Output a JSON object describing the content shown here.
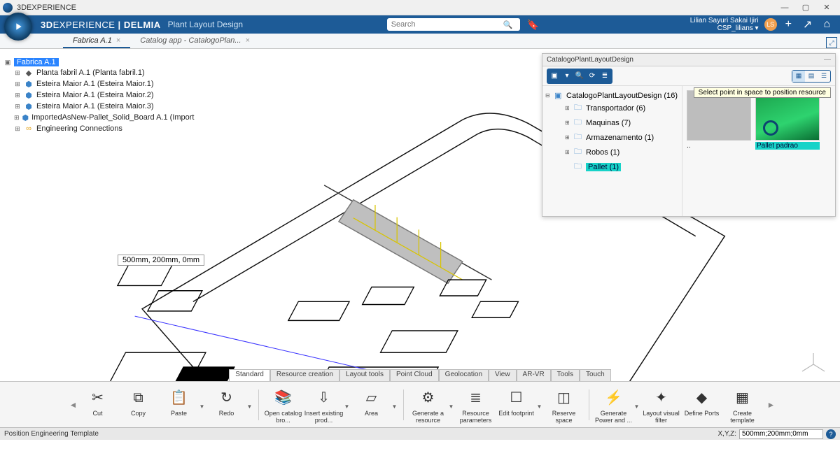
{
  "window": {
    "title": "3DEXPERIENCE"
  },
  "header": {
    "brand_bold": "3D",
    "brand_light": "EXPERIENCE",
    "divider": " | ",
    "suite": "DELMIA",
    "app": "Plant Layout Design",
    "search_placeholder": "Search",
    "user_fullname": "Lilian Sayuri Sakai Ijiri",
    "user_role": "CSP_lilians",
    "avatar_initials": "LS"
  },
  "tabs": [
    {
      "label": "Fabrica A.1",
      "active": true
    },
    {
      "label": "Catalog app - CatalogoPlan...",
      "active": false
    }
  ],
  "tree": {
    "root": "Fabrica A.1",
    "children": [
      {
        "icon": "cube",
        "label": "Planta fabril A.1 (Planta fabril.1)"
      },
      {
        "icon": "cyl",
        "label": "Esteira Maior A.1 (Esteira Maior.1)"
      },
      {
        "icon": "cyl",
        "label": "Esteira Maior A.1 (Esteira Maior.2)"
      },
      {
        "icon": "cyl",
        "label": "Esteira Maior A.1 (Esteira Maior.3)"
      },
      {
        "icon": "cyl",
        "label": "ImportedAsNew-Pallet_Solid_Board A.1 (Import"
      },
      {
        "icon": "link",
        "label": "Engineering Connections"
      }
    ]
  },
  "coord_tooltip": "500mm, 200mm, 0mm",
  "catalog": {
    "title": "CatalogoPlantLayoutDesign",
    "root": "CatalogoPlantLayoutDesign (16)",
    "folders": [
      {
        "label": "Transportador (6)"
      },
      {
        "label": "Maquinas (7)"
      },
      {
        "label": "Armazenamento (1)"
      },
      {
        "label": "Robos (1)"
      },
      {
        "label": "Pallet (1)",
        "selected": true
      }
    ],
    "thumbs": [
      {
        "kind": "gray",
        "caption": "..",
        "selected": false
      },
      {
        "kind": "pallet",
        "caption": "Pallet padrao",
        "selected": true
      }
    ],
    "tooltip": "Select point in space to position resource"
  },
  "tooltabs": [
    "Standard",
    "Resource creation",
    "Layout tools",
    "Point Cloud",
    "Geolocation",
    "View",
    "AR-VR",
    "Tools",
    "Touch"
  ],
  "tooltabs_active": "Standard",
  "toolbar": {
    "groups": {
      "edit": [
        {
          "icon": "✂",
          "label": "Cut"
        },
        {
          "icon": "⧉",
          "label": "Copy"
        },
        {
          "icon": "📋",
          "label": "Paste",
          "drop": true
        },
        {
          "icon": "↻",
          "label": "Redo",
          "drop": true
        }
      ],
      "catalog": [
        {
          "icon": "📚",
          "label": "Open catalog bro..."
        },
        {
          "icon": "⇩",
          "label": "Insert existing prod...",
          "drop": true
        },
        {
          "icon": "▱",
          "label": "Area",
          "drop": true
        }
      ],
      "resource": [
        {
          "icon": "⚙",
          "label": "Generate a resource",
          "drop": true
        },
        {
          "icon": "≣",
          "label": "Resource parameters"
        },
        {
          "icon": "☐",
          "label": "Edit footprint",
          "drop": true
        },
        {
          "icon": "◫",
          "label": "Reserve space"
        }
      ],
      "power": [
        {
          "icon": "⚡",
          "label": "Generate Power and ...",
          "drop": true
        },
        {
          "icon": "✦",
          "label": "Layout visual filter"
        },
        {
          "icon": "◆",
          "label": "Define Ports"
        },
        {
          "icon": "▦",
          "label": "Create template"
        }
      ]
    }
  },
  "status": {
    "left": "Position Engineering Template",
    "xyz_label": "X,Y,Z:",
    "xyz_value": "500mm;200mm;0mm"
  }
}
